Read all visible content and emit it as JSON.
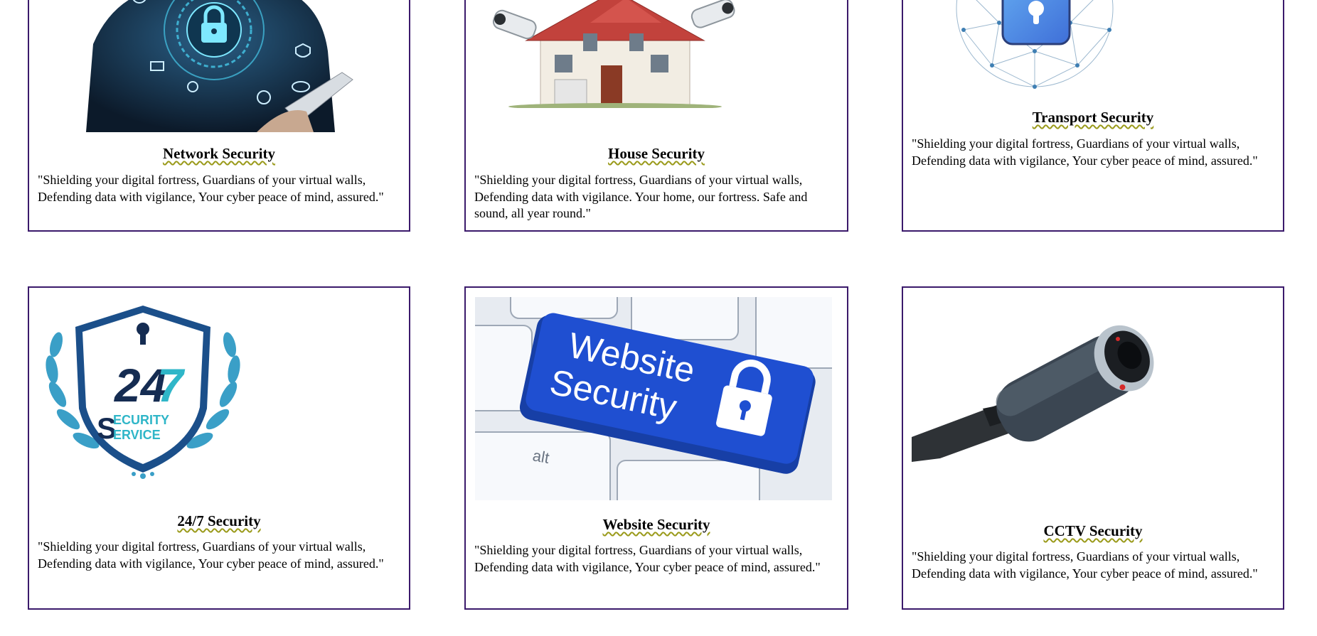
{
  "cards": [
    {
      "title": "Network Security",
      "text": "\"Shielding your digital fortress, Guardians of your virtual walls, Defending data with vigilance, Your cyber peace of mind, assured.\"",
      "image_icon": "network-lock-icon"
    },
    {
      "title": "House Security",
      "text": "\"Shielding your digital fortress, Guardians of your virtual walls, Defending data with vigilance. Your home, our fortress. Safe and sound, all year round.\"",
      "image_icon": "house-cameras-icon"
    },
    {
      "title": "Transport Security",
      "text": "\"Shielding your digital fortress, Guardians of your virtual walls, Defending data with vigilance, Your cyber peace of mind, assured.\"",
      "image_icon": "network-sphere-lock-icon"
    },
    {
      "title": "24/7 Security",
      "text": "\"Shielding your digital fortress, Guardians of your virtual walls, Defending data with vigilance, Your cyber peace of mind, assured.\"",
      "image_icon": "shield-247-icon",
      "badge": {
        "number_a": "24",
        "number_b": "7",
        "word1_rest": "ECURITY",
        "word2_rest": "ERVICE",
        "initial": "S"
      }
    },
    {
      "title": "Website Security",
      "text": "\"Shielding your digital fortress, Guardians of your virtual walls, Defending data with vigilance, Your cyber peace of mind, assured.\"",
      "image_icon": "keyboard-key-icon",
      "key": {
        "line1": "Website",
        "line2": "Security",
        "alt_key": "alt"
      }
    },
    {
      "title": "CCTV Security",
      "text": "\"Shielding your digital fortress, Guardians of your virtual walls, Defending data with vigilance, Your cyber peace of mind, assured.\"",
      "image_icon": "cctv-camera-icon"
    }
  ],
  "colors": {
    "card_border": "#3b1a6b",
    "spell_underline": "#9a9a1a",
    "key_blue": "#1f4fd1"
  }
}
